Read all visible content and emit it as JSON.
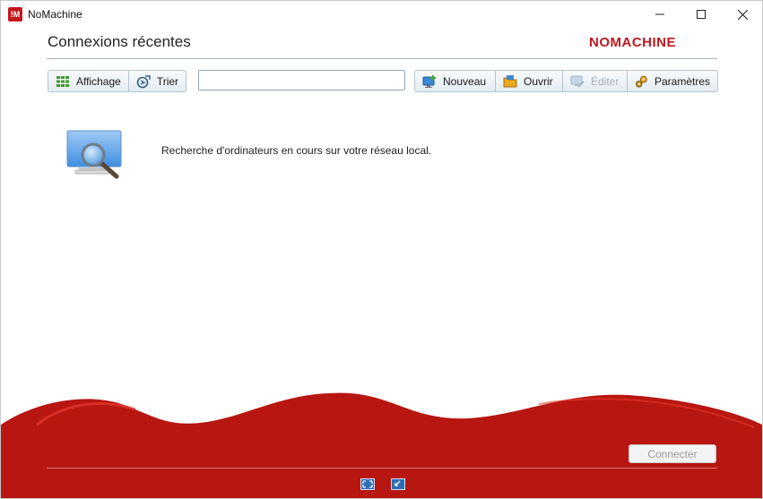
{
  "window": {
    "title": "NoMachine",
    "app_icon_text": "!M"
  },
  "header": {
    "title": "Connexions récentes",
    "brand": "NOMACHINE"
  },
  "toolbar": {
    "view_label": "Affichage",
    "sort_label": "Trier",
    "search": {
      "value": "",
      "placeholder": ""
    },
    "new_label": "Nouveau",
    "open_label": "Ouvrir",
    "edit_label": "Éditer",
    "settings_label": "Paramètres"
  },
  "main": {
    "status": "Recherche d'ordinateurs en cours sur votre réseau local."
  },
  "footer": {
    "connect_label": "Connecter"
  },
  "colors": {
    "brand_red": "#c0181d",
    "wave_red": "#b71611",
    "toolbar_border": "#b6c3d0"
  },
  "icons": [
    "grid-icon",
    "sort-icon",
    "new-connection-icon",
    "open-folder-icon",
    "edit-icon",
    "settings-gears-icon",
    "monitor-search-icon",
    "fullscreen-icon",
    "minimize-view-icon"
  ]
}
